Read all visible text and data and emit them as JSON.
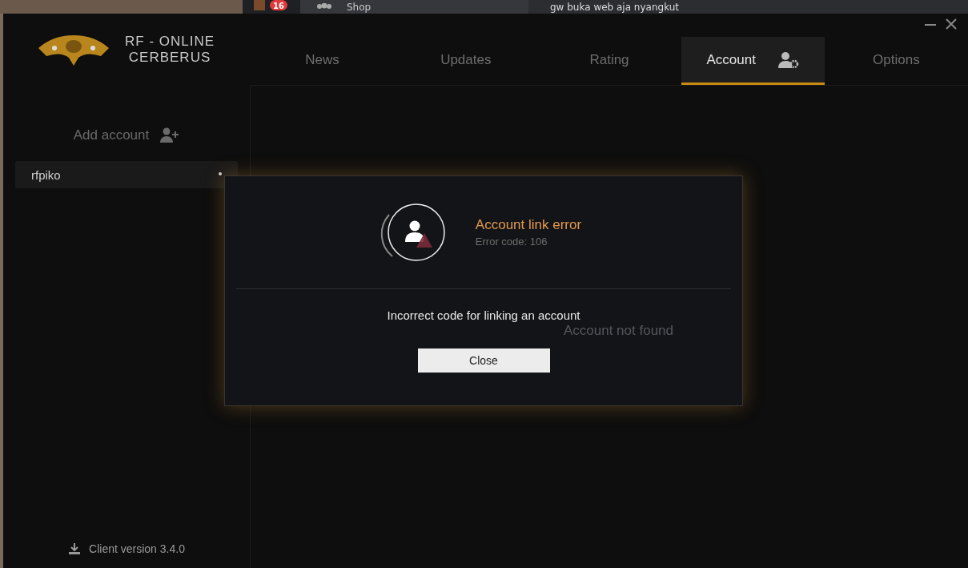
{
  "background_app": {
    "badge": "16",
    "shop_label": "Shop",
    "chat_text": "gw buka web aja nyangkut"
  },
  "brand": {
    "line_1": "RF - ONLINE",
    "line_2": "CERBERUS"
  },
  "tabs": [
    {
      "label": "News",
      "selected": false
    },
    {
      "label": "Updates",
      "selected": false
    },
    {
      "label": "Rating",
      "selected": false
    },
    {
      "label": "Account",
      "selected": true
    },
    {
      "label": "Options",
      "selected": false
    }
  ],
  "sidebar": {
    "add_account": "Add account",
    "accounts": [
      {
        "name": "rfpiko",
        "selected": true
      }
    ],
    "client_version": "Client version 3.4.0"
  },
  "content": {
    "empty_text": "Account not found"
  },
  "dialog": {
    "title": "Account link error",
    "code": "Error code: 106",
    "message": "Incorrect code for linking an account",
    "button": "Close"
  }
}
